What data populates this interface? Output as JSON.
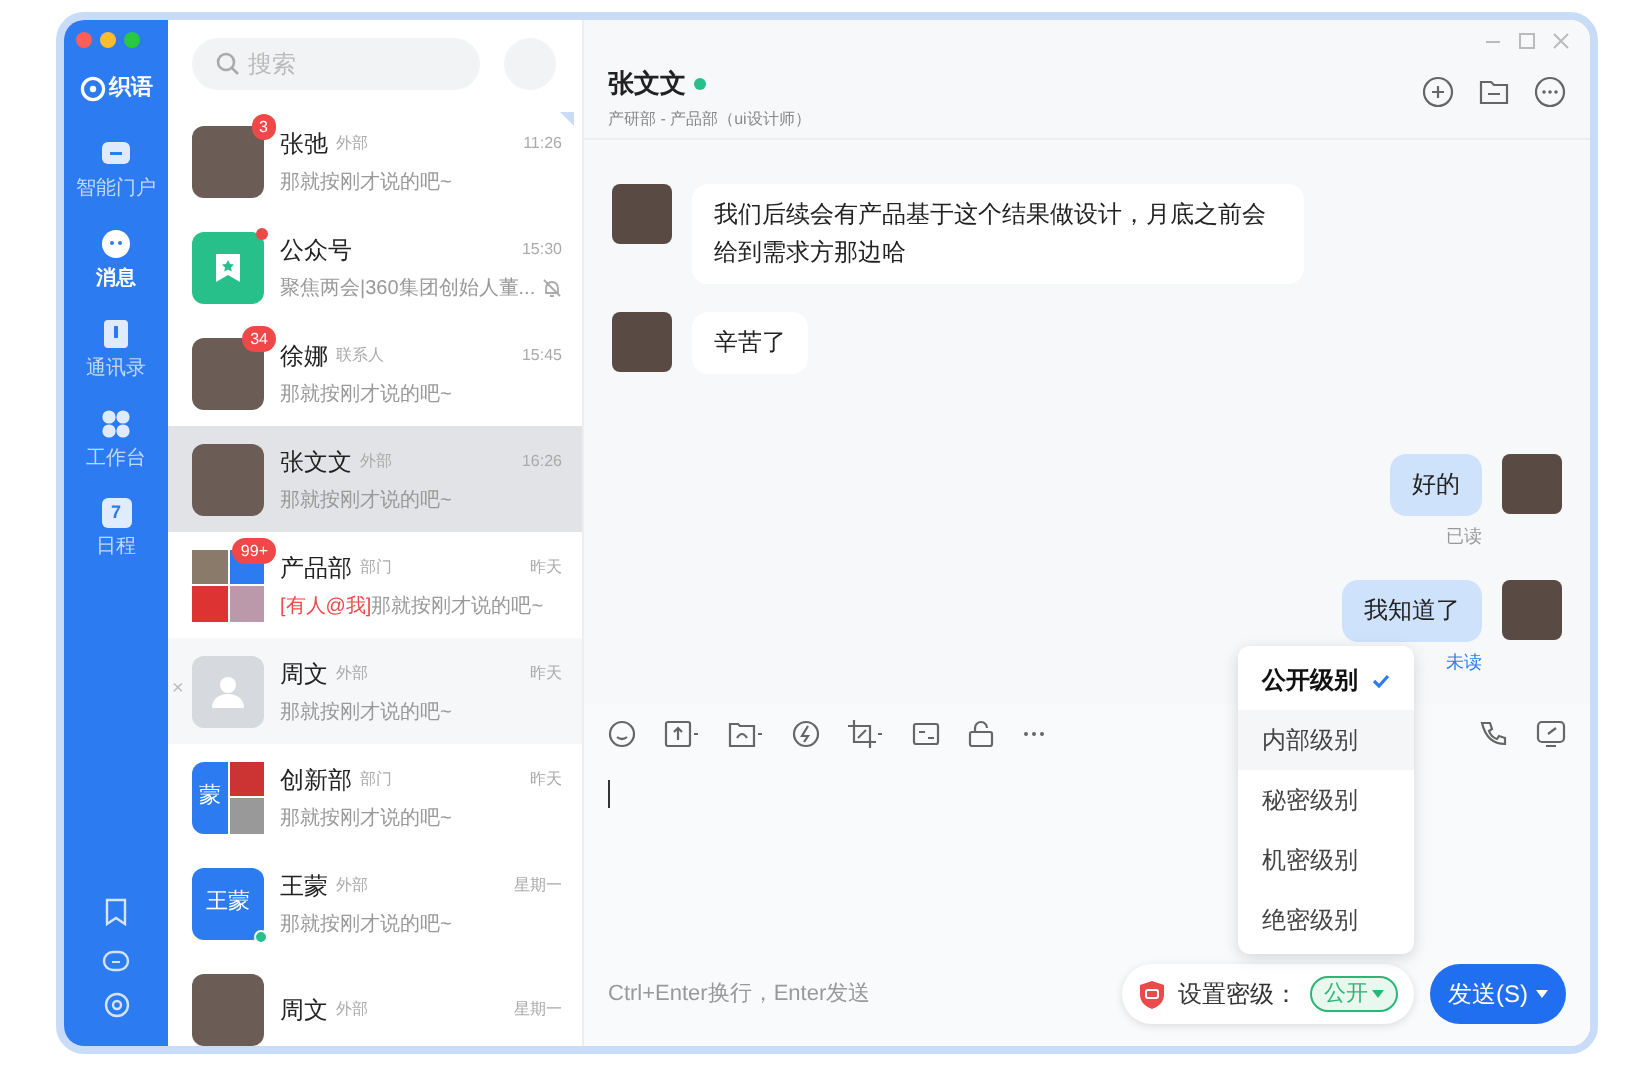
{
  "app": {
    "logo": "织语"
  },
  "nav": [
    {
      "label": "智能门户",
      "selected": false
    },
    {
      "label": "消息",
      "selected": true
    },
    {
      "label": "通讯录",
      "selected": false
    },
    {
      "label": "工作台",
      "selected": false
    },
    {
      "label": "日程",
      "day": "7",
      "selected": false
    }
  ],
  "search": {
    "placeholder": "搜索"
  },
  "conversations": [
    {
      "name": "张弛",
      "tag": "外部",
      "time": "11:26",
      "preview": "那就按刚才说的吧~",
      "kind": "photo",
      "badge": "3",
      "pinned": true,
      "selected": false
    },
    {
      "name": "公众号",
      "time": "15:30",
      "preview": "聚焦两会|360集团创始人董...",
      "kind": "app",
      "dot": true,
      "muted": true,
      "selected": false
    },
    {
      "name": "徐娜",
      "tag": "联系人",
      "time": "15:45",
      "preview": "那就按刚才说的吧~",
      "kind": "photo",
      "badge": "34",
      "selected": false
    },
    {
      "name": "张文文",
      "tag": "外部",
      "time": "16:26",
      "preview": "那就按刚才说的吧~",
      "kind": "photo",
      "selected": true
    },
    {
      "name": "产品部",
      "tag": "部门",
      "time": "昨天",
      "mention": "[有人@我]",
      "preview": "那就按刚才说的吧~",
      "kind": "group",
      "badge": "99+",
      "selected": false
    },
    {
      "name": "周文",
      "tag": "外部",
      "time": "昨天",
      "preview": "那就按刚才说的吧~",
      "kind": "placeholder",
      "close": "×",
      "selected": false
    },
    {
      "name": "创新部",
      "tag": "部门",
      "time": "昨天",
      "preview": "那就按刚才说的吧~",
      "kind": "group2",
      "group_letter": "蒙",
      "selected": false
    },
    {
      "name": "王蒙",
      "tag": "外部",
      "time": "星期一",
      "preview": "那就按刚才说的吧~",
      "kind": "text",
      "avatar_text": "王蒙",
      "online": true,
      "selected": false
    },
    {
      "name": "周文",
      "tag": "外部",
      "time": "星期一",
      "kind": "photo",
      "selected": false
    }
  ],
  "chat": {
    "title": "张文文",
    "online": true,
    "subtitle": "产研部 - 产品部（ui设计师）",
    "messages": [
      {
        "kind": "in",
        "text": "我们后续会有产品基于这个结果做设计，月底之前会给到需求方那边哈"
      },
      {
        "kind": "in",
        "text": "辛苦了"
      },
      {
        "kind": "out",
        "text": "好的",
        "status": "已读",
        "read": true
      },
      {
        "kind": "out",
        "text": "我知道了",
        "status": "未读",
        "read": false
      }
    ],
    "input_hint": "Ctrl+Enter换行，Enter发送",
    "secrecy_label": "设置密级：",
    "secrecy_value": "公开",
    "send": "发送(S)",
    "levels": [
      {
        "label": "公开级别",
        "selected": true
      },
      {
        "label": "内部级别",
        "selected": false
      },
      {
        "label": "秘密级别",
        "selected": false
      },
      {
        "label": "机密级别",
        "selected": false
      },
      {
        "label": "绝密级别",
        "selected": false
      }
    ]
  }
}
